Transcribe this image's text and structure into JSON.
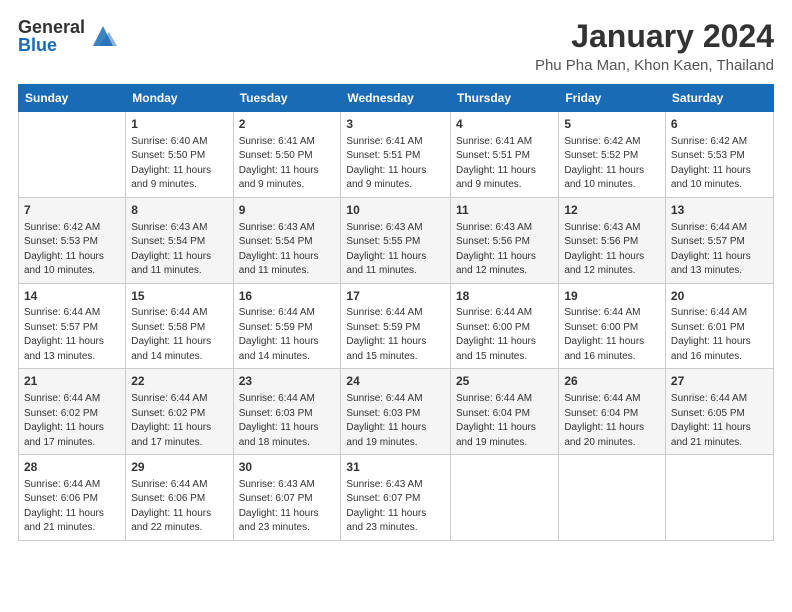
{
  "logo": {
    "general": "General",
    "blue": "Blue"
  },
  "title": "January 2024",
  "location": "Phu Pha Man, Khon Kaen, Thailand",
  "days_of_week": [
    "Sunday",
    "Monday",
    "Tuesday",
    "Wednesday",
    "Thursday",
    "Friday",
    "Saturday"
  ],
  "weeks": [
    [
      {
        "num": "",
        "info": ""
      },
      {
        "num": "1",
        "info": "Sunrise: 6:40 AM\nSunset: 5:50 PM\nDaylight: 11 hours and 9 minutes."
      },
      {
        "num": "2",
        "info": "Sunrise: 6:41 AM\nSunset: 5:50 PM\nDaylight: 11 hours and 9 minutes."
      },
      {
        "num": "3",
        "info": "Sunrise: 6:41 AM\nSunset: 5:51 PM\nDaylight: 11 hours and 9 minutes."
      },
      {
        "num": "4",
        "info": "Sunrise: 6:41 AM\nSunset: 5:51 PM\nDaylight: 11 hours and 9 minutes."
      },
      {
        "num": "5",
        "info": "Sunrise: 6:42 AM\nSunset: 5:52 PM\nDaylight: 11 hours and 10 minutes."
      },
      {
        "num": "6",
        "info": "Sunrise: 6:42 AM\nSunset: 5:53 PM\nDaylight: 11 hours and 10 minutes."
      }
    ],
    [
      {
        "num": "7",
        "info": "Sunrise: 6:42 AM\nSunset: 5:53 PM\nDaylight: 11 hours and 10 minutes."
      },
      {
        "num": "8",
        "info": "Sunrise: 6:43 AM\nSunset: 5:54 PM\nDaylight: 11 hours and 11 minutes."
      },
      {
        "num": "9",
        "info": "Sunrise: 6:43 AM\nSunset: 5:54 PM\nDaylight: 11 hours and 11 minutes."
      },
      {
        "num": "10",
        "info": "Sunrise: 6:43 AM\nSunset: 5:55 PM\nDaylight: 11 hours and 11 minutes."
      },
      {
        "num": "11",
        "info": "Sunrise: 6:43 AM\nSunset: 5:56 PM\nDaylight: 11 hours and 12 minutes."
      },
      {
        "num": "12",
        "info": "Sunrise: 6:43 AM\nSunset: 5:56 PM\nDaylight: 11 hours and 12 minutes."
      },
      {
        "num": "13",
        "info": "Sunrise: 6:44 AM\nSunset: 5:57 PM\nDaylight: 11 hours and 13 minutes."
      }
    ],
    [
      {
        "num": "14",
        "info": "Sunrise: 6:44 AM\nSunset: 5:57 PM\nDaylight: 11 hours and 13 minutes."
      },
      {
        "num": "15",
        "info": "Sunrise: 6:44 AM\nSunset: 5:58 PM\nDaylight: 11 hours and 14 minutes."
      },
      {
        "num": "16",
        "info": "Sunrise: 6:44 AM\nSunset: 5:59 PM\nDaylight: 11 hours and 14 minutes."
      },
      {
        "num": "17",
        "info": "Sunrise: 6:44 AM\nSunset: 5:59 PM\nDaylight: 11 hours and 15 minutes."
      },
      {
        "num": "18",
        "info": "Sunrise: 6:44 AM\nSunset: 6:00 PM\nDaylight: 11 hours and 15 minutes."
      },
      {
        "num": "19",
        "info": "Sunrise: 6:44 AM\nSunset: 6:00 PM\nDaylight: 11 hours and 16 minutes."
      },
      {
        "num": "20",
        "info": "Sunrise: 6:44 AM\nSunset: 6:01 PM\nDaylight: 11 hours and 16 minutes."
      }
    ],
    [
      {
        "num": "21",
        "info": "Sunrise: 6:44 AM\nSunset: 6:02 PM\nDaylight: 11 hours and 17 minutes."
      },
      {
        "num": "22",
        "info": "Sunrise: 6:44 AM\nSunset: 6:02 PM\nDaylight: 11 hours and 17 minutes."
      },
      {
        "num": "23",
        "info": "Sunrise: 6:44 AM\nSunset: 6:03 PM\nDaylight: 11 hours and 18 minutes."
      },
      {
        "num": "24",
        "info": "Sunrise: 6:44 AM\nSunset: 6:03 PM\nDaylight: 11 hours and 19 minutes."
      },
      {
        "num": "25",
        "info": "Sunrise: 6:44 AM\nSunset: 6:04 PM\nDaylight: 11 hours and 19 minutes."
      },
      {
        "num": "26",
        "info": "Sunrise: 6:44 AM\nSunset: 6:04 PM\nDaylight: 11 hours and 20 minutes."
      },
      {
        "num": "27",
        "info": "Sunrise: 6:44 AM\nSunset: 6:05 PM\nDaylight: 11 hours and 21 minutes."
      }
    ],
    [
      {
        "num": "28",
        "info": "Sunrise: 6:44 AM\nSunset: 6:06 PM\nDaylight: 11 hours and 21 minutes."
      },
      {
        "num": "29",
        "info": "Sunrise: 6:44 AM\nSunset: 6:06 PM\nDaylight: 11 hours and 22 minutes."
      },
      {
        "num": "30",
        "info": "Sunrise: 6:43 AM\nSunset: 6:07 PM\nDaylight: 11 hours and 23 minutes."
      },
      {
        "num": "31",
        "info": "Sunrise: 6:43 AM\nSunset: 6:07 PM\nDaylight: 11 hours and 23 minutes."
      },
      {
        "num": "",
        "info": ""
      },
      {
        "num": "",
        "info": ""
      },
      {
        "num": "",
        "info": ""
      }
    ]
  ]
}
